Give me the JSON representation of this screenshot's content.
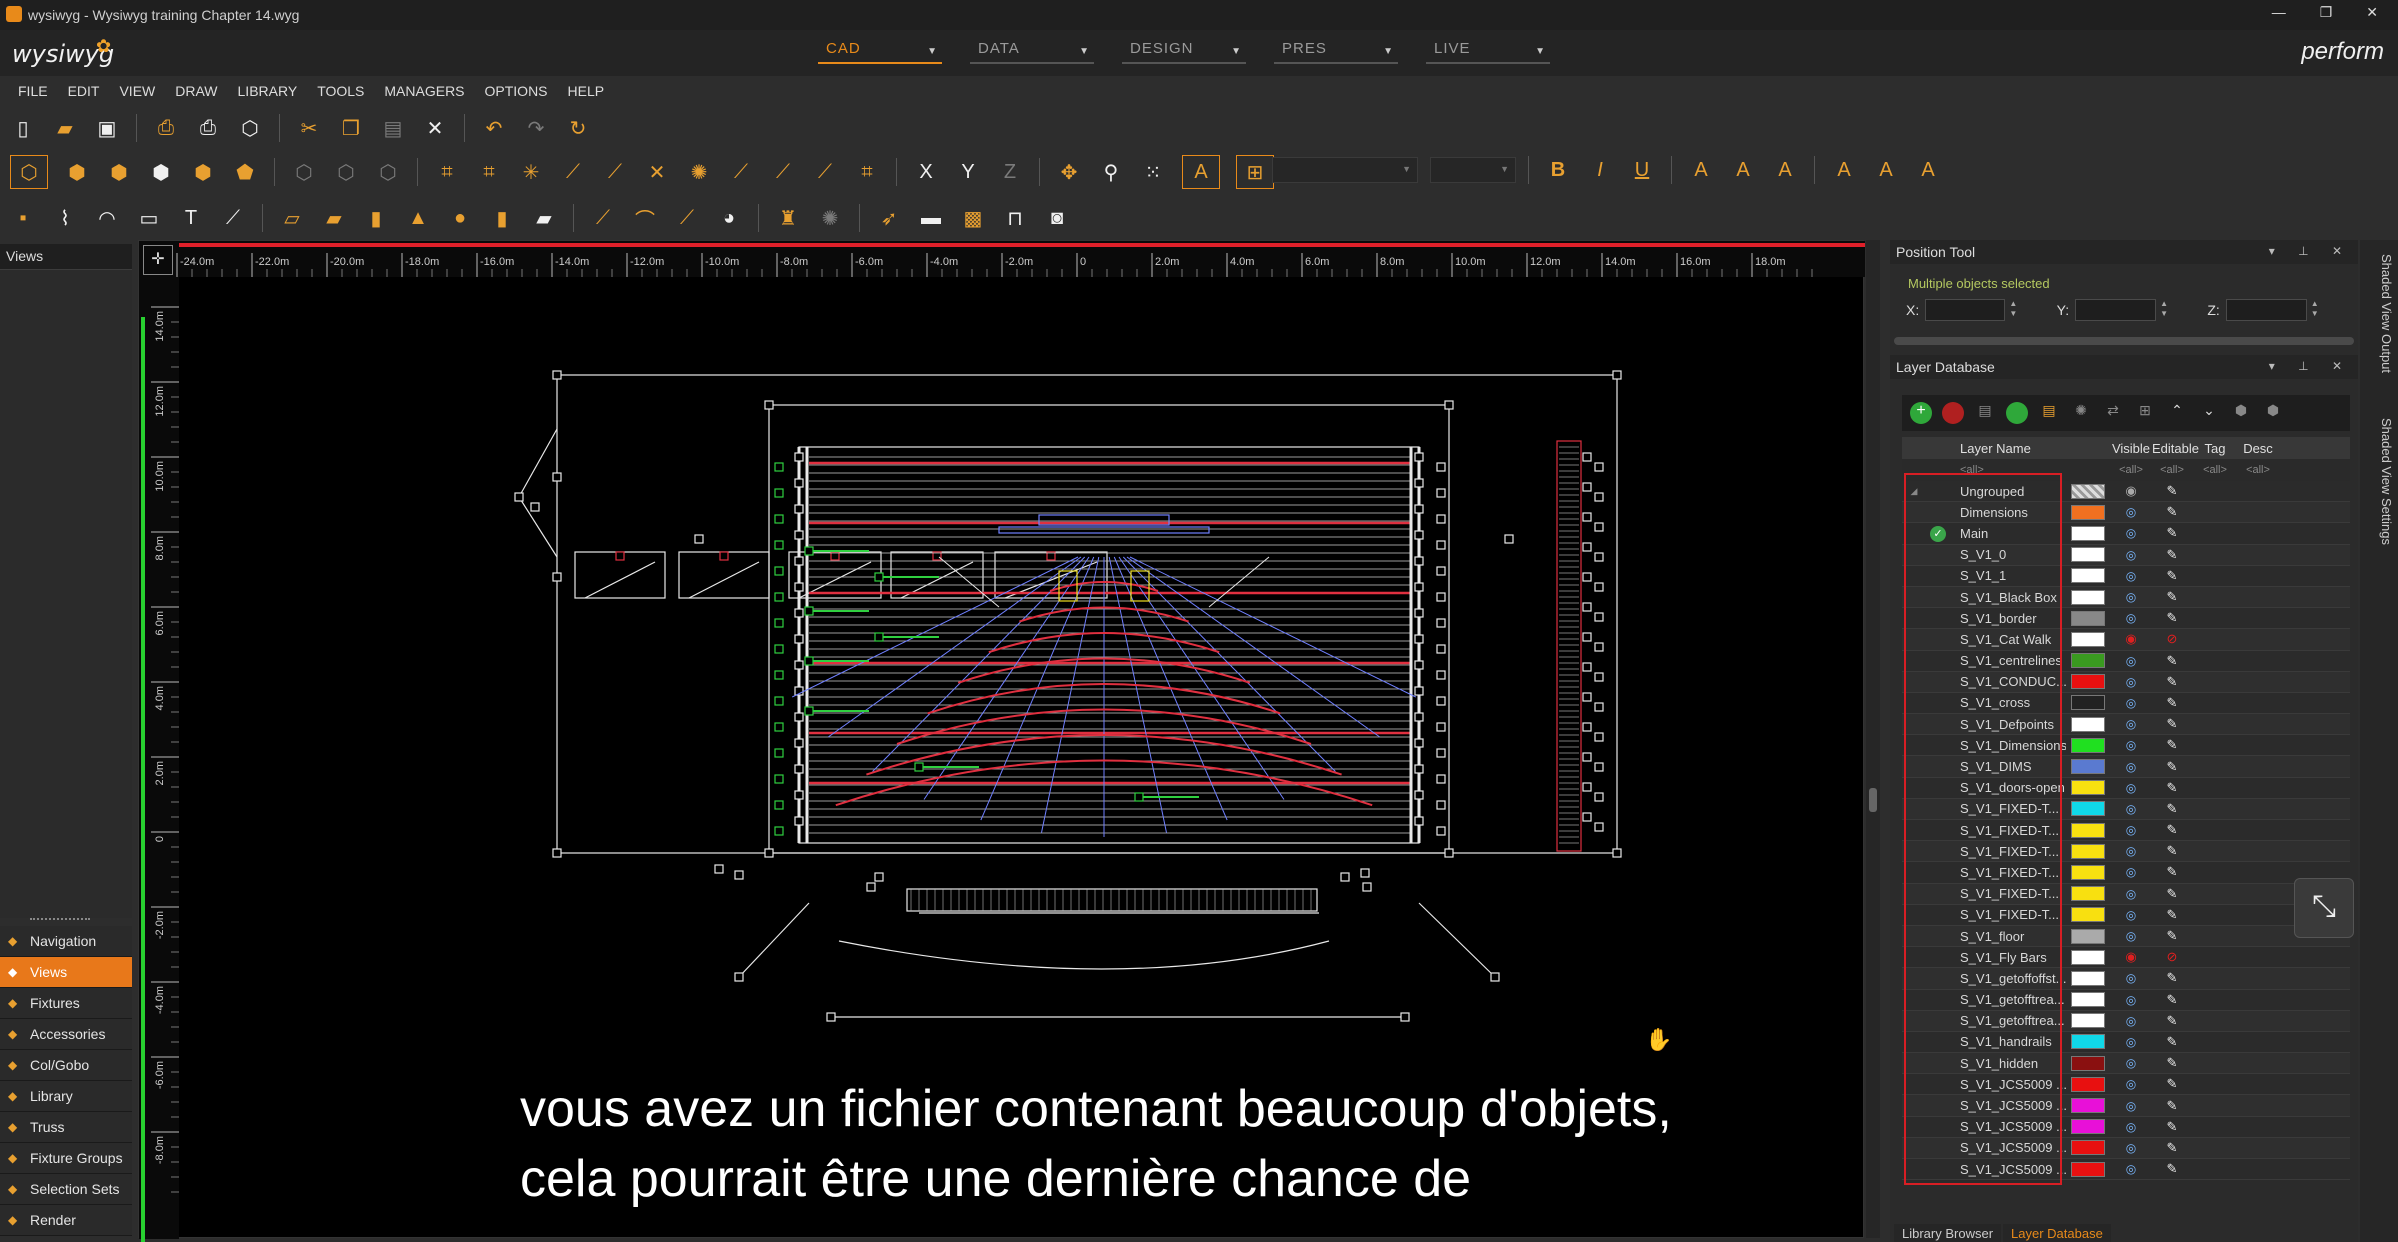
{
  "window": {
    "title": "wysiwyg - Wysiwyg training Chapter 14.wyg",
    "min": "—",
    "max": "❐",
    "close": "✕"
  },
  "brand": {
    "logo": "wysiwyg",
    "right": "perform"
  },
  "modes": [
    {
      "label": "CAD",
      "active": true
    },
    {
      "label": "DATA",
      "active": false
    },
    {
      "label": "DESIGN",
      "active": false
    },
    {
      "label": "PRES",
      "active": false
    },
    {
      "label": "LIVE",
      "active": false
    }
  ],
  "menu": [
    "FILE",
    "EDIT",
    "VIEW",
    "DRAW",
    "LIBRARY",
    "TOOLS",
    "MANAGERS",
    "OPTIONS",
    "HELP"
  ],
  "toolbar": {
    "row1": [
      "new-file-icon",
      "open-folder-icon",
      "save-icon",
      "print-preview-icon",
      "print-icon",
      "export-icon",
      "cut-icon",
      "copy-icon",
      "paste-icon",
      "delete-icon",
      "undo-icon",
      "redo-icon",
      "refresh-icon"
    ],
    "axis_labels": {
      "x": "X",
      "y": "Y",
      "z": "Z"
    },
    "format": {
      "bold": "B",
      "italic": "I",
      "underline": "U"
    }
  },
  "views_panel": {
    "title": "Views"
  },
  "nav": [
    {
      "label": "Navigation",
      "icon": "navigation-icon",
      "active": false
    },
    {
      "label": "Views",
      "icon": "views-icon",
      "active": true
    },
    {
      "label": "Fixtures",
      "icon": "fixtures-icon",
      "active": false
    },
    {
      "label": "Accessories",
      "icon": "accessories-icon",
      "active": false
    },
    {
      "label": "Col/Gobo",
      "icon": "color-gobo-icon",
      "active": false
    },
    {
      "label": "Library",
      "icon": "library-icon",
      "active": false
    },
    {
      "label": "Truss",
      "icon": "truss-icon",
      "active": false
    },
    {
      "label": "Fixture Groups",
      "icon": "fixture-groups-icon",
      "active": false
    },
    {
      "label": "Selection Sets",
      "icon": "selection-sets-icon",
      "active": false
    },
    {
      "label": "Render",
      "icon": "render-icon",
      "active": false
    }
  ],
  "ruler": {
    "top": [
      "-24.0m",
      "-22.0m",
      "-20.0m",
      "-18.0m",
      "-16.0m",
      "-14.0m",
      "-12.0m",
      "-10.0m",
      "-8.0m",
      "-6.0m",
      "-4.0m",
      "-2.0m",
      "0",
      "2.0m",
      "4.0m",
      "6.0m",
      "8.0m",
      "10.0m",
      "12.0m",
      "14.0m",
      "16.0m",
      "18.0m"
    ],
    "left": [
      "14.0m",
      "12.0m",
      "10.0m",
      "8.0m",
      "6.0m",
      "4.0m",
      "2.0m",
      "0",
      "-2.0m",
      "-4.0m",
      "-6.0m",
      "-8.0m"
    ]
  },
  "subtitle": {
    "line1": "vous avez un fichier contenant beaucoup d'objets,",
    "line2": "cela pourrait être une dernière chance de"
  },
  "position_tool": {
    "title": "Position Tool",
    "selection": "Multiple objects selected",
    "x_label": "X:",
    "y_label": "Y:",
    "z_label": "Z:"
  },
  "layer_db": {
    "title": "Layer Database",
    "columns": {
      "name": "Layer Name",
      "visible": "Visible",
      "editable": "Editable",
      "tag": "Tag",
      "desc": "Desc"
    },
    "filter": {
      "name": "<all>",
      "visible": "<all>",
      "editable": "<all>",
      "tag": "<all>",
      "desc": "<all>"
    },
    "rows": [
      {
        "name": "Ungrouped",
        "color": "#cccccc",
        "pattern": true,
        "vis": "grey",
        "edit": "pen"
      },
      {
        "name": "Dimensions",
        "color": "#f07020",
        "vis": "eye",
        "edit": "pen"
      },
      {
        "name": "Main",
        "color": "#ffffff",
        "current": true,
        "vis": "eye",
        "edit": "pen"
      },
      {
        "name": "S_V1_0",
        "color": "#ffffff",
        "vis": "eye",
        "edit": "pen"
      },
      {
        "name": "S_V1_1",
        "color": "#ffffff",
        "vis": "eye",
        "edit": "pen"
      },
      {
        "name": "S_V1_Black Box",
        "color": "#ffffff",
        "vis": "eye",
        "edit": "pen"
      },
      {
        "name": "S_V1_border",
        "color": "#888888",
        "vis": "eye",
        "edit": "pen"
      },
      {
        "name": "S_V1_Cat Walk",
        "color": "#ffffff",
        "vis": "off",
        "edit": "locked"
      },
      {
        "name": "S_V1_centrelines",
        "color": "#3a9a20",
        "vis": "eye",
        "edit": "pen"
      },
      {
        "name": "S_V1_CONDUC...",
        "color": "#e81010",
        "vis": "eye",
        "edit": "pen"
      },
      {
        "name": "S_V1_cross",
        "color": "#222222",
        "vis": "eye",
        "edit": "pen"
      },
      {
        "name": "S_V1_Defpoints",
        "color": "#ffffff",
        "vis": "eye",
        "edit": "pen"
      },
      {
        "name": "S_V1_Dimensions",
        "color": "#20e020",
        "vis": "eye",
        "edit": "pen"
      },
      {
        "name": "S_V1_DIMS",
        "color": "#5a7ad0",
        "vis": "eye",
        "edit": "pen"
      },
      {
        "name": "S_V1_doors-open",
        "color": "#f8e010",
        "vis": "eye",
        "edit": "pen"
      },
      {
        "name": "S_V1_FIXED-T...",
        "color": "#10d8e8",
        "vis": "eye",
        "edit": "pen"
      },
      {
        "name": "S_V1_FIXED-T...",
        "color": "#f8e010",
        "vis": "eye",
        "edit": "pen"
      },
      {
        "name": "S_V1_FIXED-T...",
        "color": "#f8e010",
        "vis": "eye",
        "edit": "pen"
      },
      {
        "name": "S_V1_FIXED-T...",
        "color": "#f8e010",
        "vis": "eye",
        "edit": "pen"
      },
      {
        "name": "S_V1_FIXED-T...",
        "color": "#f8e010",
        "vis": "eye",
        "edit": "pen"
      },
      {
        "name": "S_V1_FIXED-T...",
        "color": "#f8e010",
        "vis": "eye",
        "edit": "pen"
      },
      {
        "name": "S_V1_floor",
        "color": "#aaaaaa",
        "vis": "eye",
        "edit": "pen"
      },
      {
        "name": "S_V1_Fly Bars",
        "color": "#ffffff",
        "vis": "off",
        "edit": "locked"
      },
      {
        "name": "S_V1_getoffoffst...",
        "color": "#ffffff",
        "vis": "eye",
        "edit": "pen"
      },
      {
        "name": "S_V1_getofftrea...",
        "color": "#ffffff",
        "vis": "eye",
        "edit": "pen"
      },
      {
        "name": "S_V1_getofftrea...",
        "color": "#ffffff",
        "vis": "eye",
        "edit": "pen"
      },
      {
        "name": "S_V1_handrails",
        "color": "#10d8e8",
        "vis": "eye",
        "edit": "pen"
      },
      {
        "name": "S_V1_hidden",
        "color": "#8a1010",
        "vis": "eye",
        "edit": "pen"
      },
      {
        "name": "S_V1_JCS5009 ...",
        "color": "#e81010",
        "vis": "eye",
        "edit": "pen"
      },
      {
        "name": "S_V1_JCS5009 ...",
        "color": "#e810d8",
        "vis": "eye",
        "edit": "pen"
      },
      {
        "name": "S_V1_JCS5009 ...",
        "color": "#e810d8",
        "vis": "eye",
        "edit": "pen"
      },
      {
        "name": "S_V1_JCS5009 ...",
        "color": "#e81010",
        "vis": "eye",
        "edit": "pen"
      },
      {
        "name": "S_V1_JCS5009 ...",
        "color": "#e81010",
        "vis": "eye",
        "edit": "pen"
      }
    ]
  },
  "bottom_tabs": [
    {
      "label": "Library Browser",
      "active": false
    },
    {
      "label": "Layer Database",
      "active": true
    }
  ],
  "side_tabs": [
    "Shaded View Output",
    "Shaded View Settings"
  ],
  "colors": {
    "accent": "#e8781a",
    "ruler_top": "#e0202a",
    "ruler_left": "#28d030",
    "highlight_box": "#d81e24"
  }
}
